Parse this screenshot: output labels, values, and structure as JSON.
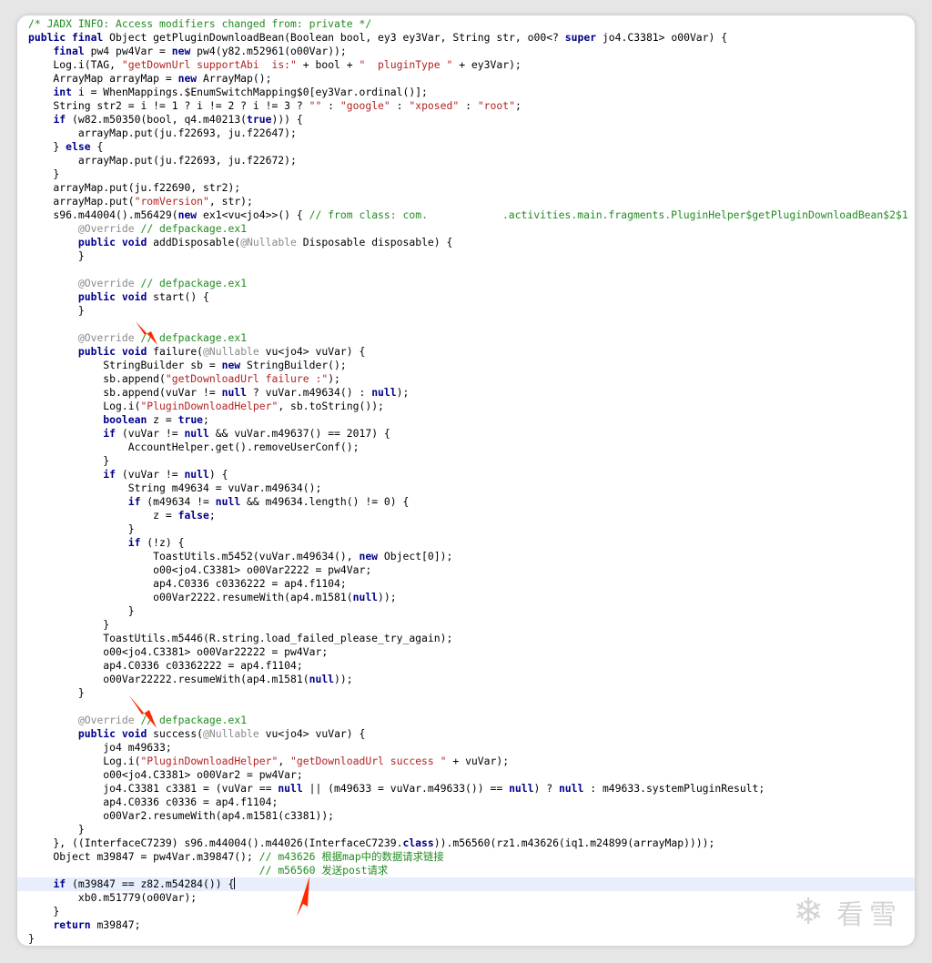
{
  "colors": {
    "keyword": "#00008b",
    "string": "#b22222",
    "comment": "#228b22",
    "annotation": "#8a8a8a",
    "arrow": "#ff2a00"
  },
  "watermark": {
    "text": "看雪",
    "icon": "snowflake-icon"
  },
  "lines": [
    [
      [
        "c",
        "/* JADX INFO: Access modifiers changed from: private */"
      ]
    ],
    [
      [
        "k",
        "public final"
      ],
      [
        "t",
        " Object getPluginDownloadBean(Boolean bool, ey3 ey3Var, String str, o00<? "
      ],
      [
        "k",
        "super"
      ],
      [
        "t",
        " jo4.C3381> o00Var) {"
      ]
    ],
    [
      [
        "t",
        "    "
      ],
      [
        "k",
        "final"
      ],
      [
        "t",
        " pw4 pw4Var = "
      ],
      [
        "k",
        "new"
      ],
      [
        "t",
        " pw4(y82.m52961(o00Var));"
      ]
    ],
    [
      [
        "t",
        "    Log.i(TAG, "
      ],
      [
        "s",
        "\"getDownUrl supportAbi  is:\""
      ],
      [
        "t",
        " + bool + "
      ],
      [
        "s",
        "\"  pluginType \""
      ],
      [
        "t",
        " + ey3Var);"
      ]
    ],
    [
      [
        "t",
        "    ArrayMap arrayMap = "
      ],
      [
        "k",
        "new"
      ],
      [
        "t",
        " ArrayMap();"
      ]
    ],
    [
      [
        "t",
        "    "
      ],
      [
        "k",
        "int"
      ],
      [
        "t",
        " i = WhenMappings.$EnumSwitchMapping$0[ey3Var.ordinal()];"
      ]
    ],
    [
      [
        "t",
        "    String str2 = i != 1 ? i != 2 ? i != 3 ? "
      ],
      [
        "s",
        "\"\""
      ],
      [
        "t",
        " : "
      ],
      [
        "s",
        "\"google\""
      ],
      [
        "t",
        " : "
      ],
      [
        "s",
        "\"xposed\""
      ],
      [
        "t",
        " : "
      ],
      [
        "s",
        "\"root\""
      ],
      [
        "t",
        ";"
      ]
    ],
    [
      [
        "t",
        "    "
      ],
      [
        "k",
        "if"
      ],
      [
        "t",
        " (w82.m50350(bool, q4.m40213("
      ],
      [
        "k",
        "true"
      ],
      [
        "t",
        "))) {"
      ]
    ],
    [
      [
        "t",
        "        arrayMap.put(ju.f22693, ju.f22647);"
      ]
    ],
    [
      [
        "t",
        "    } "
      ],
      [
        "k",
        "else"
      ],
      [
        "t",
        " {"
      ]
    ],
    [
      [
        "t",
        "        arrayMap.put(ju.f22693, ju.f22672);"
      ]
    ],
    [
      [
        "t",
        "    }"
      ]
    ],
    [
      [
        "t",
        "    arrayMap.put(ju.f22690, str2);"
      ]
    ],
    [
      [
        "t",
        "    arrayMap.put("
      ],
      [
        "s",
        "\"romVersion\""
      ],
      [
        "t",
        ", str);"
      ]
    ],
    [
      [
        "t",
        "    s96.m44004().m56429("
      ],
      [
        "k",
        "new"
      ],
      [
        "t",
        " ex1<vu<jo4>>() { "
      ],
      [
        "c",
        "// from class: com."
      ],
      [
        "r",
        ""
      ],
      [
        "c",
        ".activities.main.fragments.PluginHelper$getPluginDownloadBean$2$1"
      ]
    ],
    [
      [
        "t",
        "        "
      ],
      [
        "a",
        "@Override"
      ],
      [
        "t",
        " "
      ],
      [
        "c",
        "// defpackage.ex1"
      ]
    ],
    [
      [
        "t",
        "        "
      ],
      [
        "k",
        "public void"
      ],
      [
        "t",
        " addDisposable("
      ],
      [
        "a",
        "@Nullable"
      ],
      [
        "t",
        " Disposable disposable) {"
      ]
    ],
    [
      [
        "t",
        "        }"
      ]
    ],
    [
      [
        "t",
        ""
      ]
    ],
    [
      [
        "t",
        "        "
      ],
      [
        "a",
        "@Override"
      ],
      [
        "t",
        " "
      ],
      [
        "c",
        "// defpackage.ex1"
      ]
    ],
    [
      [
        "t",
        "        "
      ],
      [
        "k",
        "public void"
      ],
      [
        "t",
        " start() {"
      ]
    ],
    [
      [
        "t",
        "        }"
      ]
    ],
    [
      [
        "t",
        ""
      ]
    ],
    [
      [
        "t",
        "        "
      ],
      [
        "a",
        "@Override"
      ],
      [
        "t",
        " "
      ],
      [
        "c",
        "// defpackage.ex1"
      ]
    ],
    [
      [
        "t",
        "        "
      ],
      [
        "k",
        "public void"
      ],
      [
        "t",
        " failure("
      ],
      [
        "a",
        "@Nullable"
      ],
      [
        "t",
        " vu<jo4> vuVar) {"
      ]
    ],
    [
      [
        "t",
        "            StringBuilder sb = "
      ],
      [
        "k",
        "new"
      ],
      [
        "t",
        " StringBuilder();"
      ]
    ],
    [
      [
        "t",
        "            sb.append("
      ],
      [
        "s",
        "\"getDownloadUrl failure :\""
      ],
      [
        "t",
        ");"
      ]
    ],
    [
      [
        "t",
        "            sb.append(vuVar != "
      ],
      [
        "k",
        "null"
      ],
      [
        "t",
        " ? vuVar.m49634() : "
      ],
      [
        "k",
        "null"
      ],
      [
        "t",
        ");"
      ]
    ],
    [
      [
        "t",
        "            Log.i("
      ],
      [
        "s",
        "\"PluginDownloadHelper\""
      ],
      [
        "t",
        ", sb.toString());"
      ]
    ],
    [
      [
        "t",
        "            "
      ],
      [
        "k",
        "boolean"
      ],
      [
        "t",
        " z = "
      ],
      [
        "k",
        "true"
      ],
      [
        "t",
        ";"
      ]
    ],
    [
      [
        "t",
        "            "
      ],
      [
        "k",
        "if"
      ],
      [
        "t",
        " (vuVar != "
      ],
      [
        "k",
        "null"
      ],
      [
        "t",
        " && vuVar.m49637() == 2017) {"
      ]
    ],
    [
      [
        "t",
        "                AccountHelper.get().removeUserConf();"
      ]
    ],
    [
      [
        "t",
        "            }"
      ]
    ],
    [
      [
        "t",
        "            "
      ],
      [
        "k",
        "if"
      ],
      [
        "t",
        " (vuVar != "
      ],
      [
        "k",
        "null"
      ],
      [
        "t",
        ") {"
      ]
    ],
    [
      [
        "t",
        "                String m49634 = vuVar.m49634();"
      ]
    ],
    [
      [
        "t",
        "                "
      ],
      [
        "k",
        "if"
      ],
      [
        "t",
        " (m49634 != "
      ],
      [
        "k",
        "null"
      ],
      [
        "t",
        " && m49634.length() != 0) {"
      ]
    ],
    [
      [
        "t",
        "                    z = "
      ],
      [
        "k",
        "false"
      ],
      [
        "t",
        ";"
      ]
    ],
    [
      [
        "t",
        "                }"
      ]
    ],
    [
      [
        "t",
        "                "
      ],
      [
        "k",
        "if"
      ],
      [
        "t",
        " (!z) {"
      ]
    ],
    [
      [
        "t",
        "                    ToastUtils.m5452(vuVar.m49634(), "
      ],
      [
        "k",
        "new"
      ],
      [
        "t",
        " Object[0]);"
      ]
    ],
    [
      [
        "t",
        "                    o00<jo4.C3381> o00Var2222 = pw4Var;"
      ]
    ],
    [
      [
        "t",
        "                    ap4.C0336 c0336222 = ap4.f1104;"
      ]
    ],
    [
      [
        "t",
        "                    o00Var2222.resumeWith(ap4.m1581("
      ],
      [
        "k",
        "null"
      ],
      [
        "t",
        "));"
      ]
    ],
    [
      [
        "t",
        "                }"
      ]
    ],
    [
      [
        "t",
        "            }"
      ]
    ],
    [
      [
        "t",
        "            ToastUtils.m5446(R.string.load_failed_please_try_again);"
      ]
    ],
    [
      [
        "t",
        "            o00<jo4.C3381> o00Var22222 = pw4Var;"
      ]
    ],
    [
      [
        "t",
        "            ap4.C0336 c03362222 = ap4.f1104;"
      ]
    ],
    [
      [
        "t",
        "            o00Var22222.resumeWith(ap4.m1581("
      ],
      [
        "k",
        "null"
      ],
      [
        "t",
        "));"
      ]
    ],
    [
      [
        "t",
        "        }"
      ]
    ],
    [
      [
        "t",
        ""
      ]
    ],
    [
      [
        "t",
        "        "
      ],
      [
        "a",
        "@Override"
      ],
      [
        "t",
        " "
      ],
      [
        "c",
        "// defpackage.ex1"
      ]
    ],
    [
      [
        "t",
        "        "
      ],
      [
        "k",
        "public void"
      ],
      [
        "t",
        " success("
      ],
      [
        "a",
        "@Nullable"
      ],
      [
        "t",
        " vu<jo4> vuVar) {"
      ]
    ],
    [
      [
        "t",
        "            jo4 m49633;"
      ]
    ],
    [
      [
        "t",
        "            Log.i("
      ],
      [
        "s",
        "\"PluginDownloadHelper\""
      ],
      [
        "t",
        ", "
      ],
      [
        "s",
        "\"getDownloadUrl success \""
      ],
      [
        "t",
        " + vuVar);"
      ]
    ],
    [
      [
        "t",
        "            o00<jo4.C3381> o00Var2 = pw4Var;"
      ]
    ],
    [
      [
        "t",
        "            jo4.C3381 c3381 = (vuVar == "
      ],
      [
        "k",
        "null"
      ],
      [
        "t",
        " || (m49633 = vuVar.m49633()) == "
      ],
      [
        "k",
        "null"
      ],
      [
        "t",
        ") ? "
      ],
      [
        "k",
        "null"
      ],
      [
        "t",
        " : m49633.systemPluginResult;"
      ]
    ],
    [
      [
        "t",
        "            ap4.C0336 c0336 = ap4.f1104;"
      ]
    ],
    [
      [
        "t",
        "            o00Var2.resumeWith(ap4.m1581(c3381));"
      ]
    ],
    [
      [
        "t",
        "        }"
      ]
    ],
    [
      [
        "t",
        "    }, ((InterfaceC7239) s96.m44004().m44026(InterfaceC7239."
      ],
      [
        "k",
        "class"
      ],
      [
        "t",
        ")).m56560(rz1.m43626(iq1.m24899(arrayMap))));"
      ]
    ],
    [
      [
        "t",
        "    Object m39847 = pw4Var.m39847(); "
      ],
      [
        "c",
        "// m43626 根据map中的数据请求链接"
      ]
    ],
    [
      [
        "t",
        "                                     "
      ],
      [
        "c",
        "// m56560 发送post请求"
      ]
    ],
    [
      [
        "t",
        "    "
      ],
      [
        "k",
        "if"
      ],
      [
        "t",
        " (m39847 == z82.m54284()) {"
      ],
      [
        "cur",
        ""
      ]
    ],
    [
      [
        "t",
        "        xb0.m51779(o00Var);"
      ]
    ],
    [
      [
        "t",
        "    }"
      ]
    ],
    [
      [
        "t",
        "    "
      ],
      [
        "k",
        "return"
      ],
      [
        "t",
        " m39847;"
      ]
    ],
    [
      [
        "t",
        "}"
      ]
    ]
  ]
}
